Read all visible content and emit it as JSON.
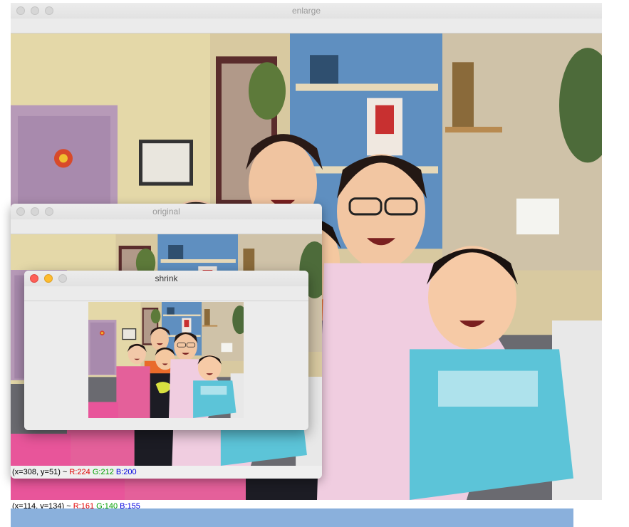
{
  "windows": {
    "enlarge": {
      "title": "enlarge",
      "status": {
        "coords": "(x=114, y=134) ~ ",
        "r": "R:161",
        "g": "G:140",
        "b": "B:155"
      }
    },
    "original": {
      "title": "original",
      "status": {
        "coords": "(x=308, y=51) ~ ",
        "r": "R:224",
        "g": "G:212",
        "b": "B:200"
      }
    },
    "shrink": {
      "title": "shrink"
    }
  },
  "icons": {
    "traffic_lights": [
      "close-button",
      "minimize-button",
      "zoom-button"
    ]
  }
}
